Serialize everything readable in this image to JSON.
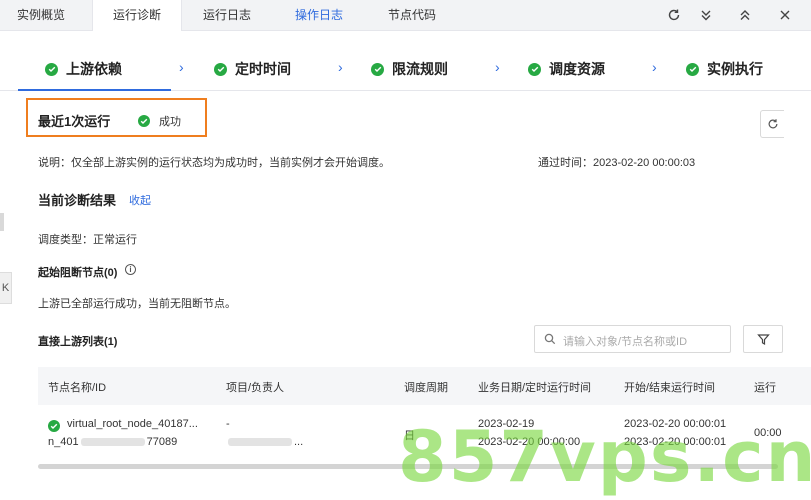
{
  "tabs": [
    {
      "label": "实例概览"
    },
    {
      "label": "运行诊断"
    },
    {
      "label": "运行日志"
    },
    {
      "label": "操作日志"
    },
    {
      "label": "节点代码"
    }
  ],
  "steps": [
    {
      "label": "上游依赖"
    },
    {
      "label": "定时时间"
    },
    {
      "label": "限流规则"
    },
    {
      "label": "调度资源"
    },
    {
      "label": "实例执行"
    }
  ],
  "latest_run": {
    "title": "最近1次运行",
    "status": "成功"
  },
  "description": "说明：仅全部上游实例的运行状态均为成功时，当前实例才会开始调度。",
  "pass_time": "通过时间：2023-02-20 00:00:03",
  "diagnosis": {
    "title": "当前诊断结果",
    "collapse_label": "收起",
    "schedule_type": "调度类型：正常运行",
    "blocking_title": "起始阻断节点(0)",
    "blocking_text": "上游已全部运行成功，当前无阻断节点。"
  },
  "upstream": {
    "title": "直接上游列表(1)",
    "search_placeholder": "请输入对象/节点名称或ID",
    "columns": [
      "节点名称/ID",
      "项目/负责人",
      "调度周期",
      "业务日期/定时运行时间",
      "开始/结束运行时间",
      "运行"
    ],
    "rows": [
      {
        "name": "virtual_root_node_40187...",
        "id_prefix": "n_401",
        "id_suffix": "77089",
        "project": "-",
        "owner_tail": "...",
        "period": "日",
        "biz_date": "2023-02-19",
        "sched_time": "2023-02-20 00:00:00",
        "start_time": "2023-02-20 00:00:01",
        "end_time": "2023-02-20 00:00:01",
        "run": "00:00"
      }
    ]
  },
  "left_tab_label": "K",
  "watermark": "857vps.cn",
  "colors": {
    "accent": "#2f6bde",
    "success": "#27a943",
    "highlight_border": "#ef7e1f"
  }
}
